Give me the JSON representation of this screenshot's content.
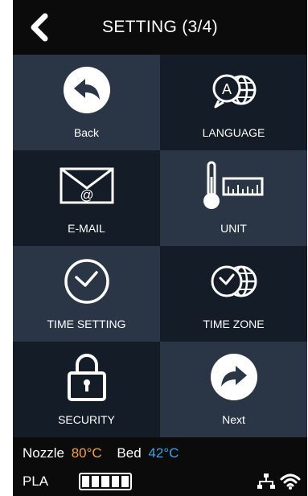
{
  "header": {
    "title": "SETTING (3/4)"
  },
  "tiles": [
    {
      "label": "Back",
      "icon": "back-arrow-icon"
    },
    {
      "label": "LANGUAGE",
      "icon": "language-globe-icon"
    },
    {
      "label": "E-MAIL",
      "icon": "envelope-icon"
    },
    {
      "label": "UNIT",
      "icon": "thermometer-ruler-icon"
    },
    {
      "label": "TIME SETTING",
      "icon": "clock-icon"
    },
    {
      "label": "TIME ZONE",
      "icon": "clock-globe-icon"
    },
    {
      "label": "SECURITY",
      "icon": "padlock-icon"
    },
    {
      "label": "Next",
      "icon": "next-arrow-icon"
    }
  ],
  "status": {
    "nozzle_label": "Nozzle",
    "nozzle_temp": "80°C",
    "bed_label": "Bed",
    "bed_temp": "42°C",
    "material": "PLA",
    "filament_level": 1.0
  },
  "colors": {
    "nozzle_temp": "#f4a246",
    "bed_temp": "#3aa3e6",
    "tile_light": "#2a3646",
    "tile_dark": "#141c27"
  }
}
